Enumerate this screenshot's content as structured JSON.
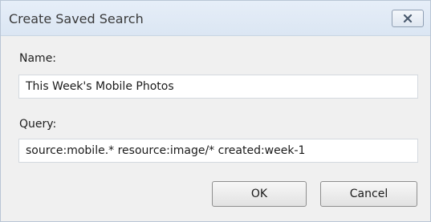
{
  "dialog": {
    "title": "Create Saved Search",
    "close_icon": "close-icon"
  },
  "form": {
    "name_label": "Name:",
    "name_value": "This Week's Mobile Photos",
    "query_label": "Query:",
    "query_value": "source:mobile.* resource:image/* created:week-1"
  },
  "buttons": {
    "ok_label": "OK",
    "cancel_label": "Cancel"
  }
}
